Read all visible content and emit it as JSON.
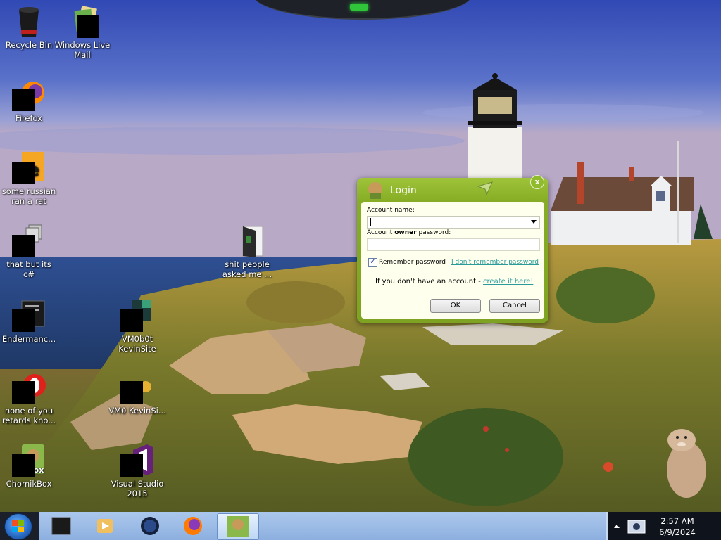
{
  "desktop": {
    "icons": [
      {
        "label": "Recycle Bin"
      },
      {
        "label": "Windows Live Mail"
      },
      {
        "label": "Firefox"
      },
      {
        "label": "some russian ran a rat"
      },
      {
        "label": "that but its c#"
      },
      {
        "label": "shit people asked me ..."
      },
      {
        "label": "Endermanc..."
      },
      {
        "label": "VM0b0t KevinSite"
      },
      {
        "label": "none of you retards kno..."
      },
      {
        "label": "VM0 KevinSi..."
      },
      {
        "label": "ChomikBox"
      },
      {
        "label": "Visual Studio 2015"
      }
    ]
  },
  "login": {
    "title": "Login",
    "account_name_label": "Account name:",
    "password_label_pre": "Account ",
    "password_label_bold": "owner",
    "password_label_post": " password:",
    "account_name_value": "",
    "password_value": "",
    "remember_label": "Remember password",
    "remember_checked": true,
    "forgot_link": "I don't remember password",
    "no_account_text": "If you don't have an account - ",
    "create_link": "create it here!",
    "ok_label": "OK",
    "cancel_label": "Cancel",
    "close_glyph": "x"
  },
  "taskbar": {
    "time": "2:57 AM",
    "date": "6/9/2024"
  },
  "colors": {
    "dialog_green": "#86ad25",
    "link_teal": "#2a9a9a",
    "taskbar_blue": "#9dbce6"
  }
}
